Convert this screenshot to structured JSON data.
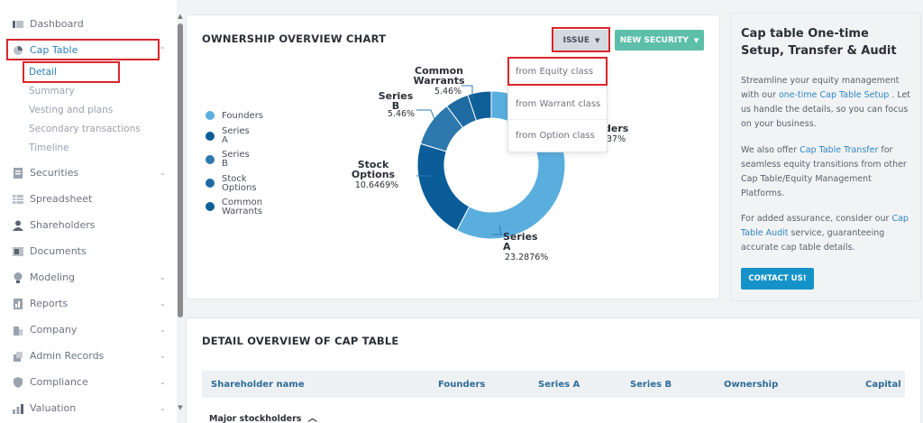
{
  "sidebar": {
    "items": [
      {
        "label": "Dashboard",
        "icon": "dashboard-icon",
        "chevron": false
      },
      {
        "label": "Cap Table",
        "icon": "pie-chart-icon",
        "chevron": true
      },
      {
        "label": "Securities",
        "icon": "securities-icon",
        "chevron": true
      },
      {
        "label": "Spreadsheet",
        "icon": "spreadsheet-icon",
        "chevron": false
      },
      {
        "label": "Shareholders",
        "icon": "user-icon",
        "chevron": false
      },
      {
        "label": "Documents",
        "icon": "document-icon",
        "chevron": false
      },
      {
        "label": "Modeling",
        "icon": "bulb-icon",
        "chevron": true
      },
      {
        "label": "Reports",
        "icon": "report-icon",
        "chevron": true
      },
      {
        "label": "Company",
        "icon": "company-icon",
        "chevron": true
      },
      {
        "label": "Admin Records",
        "icon": "admin-icon",
        "chevron": true
      },
      {
        "label": "Compliance",
        "icon": "shield-icon",
        "chevron": true
      },
      {
        "label": "Valuation",
        "icon": "valuation-icon",
        "chevron": true
      }
    ],
    "cap_table_sub": [
      "Detail",
      "Summary",
      "Vesting and plans",
      "Secondary transactions",
      "Timeline"
    ]
  },
  "chart_card": {
    "title": "OWNERSHIP OVERVIEW CHART",
    "issue_label": "ISSUE",
    "new_security_label": "NEW SECURITY",
    "dropdown": [
      "from Equity class",
      "from Warrant class",
      "from Option class"
    ]
  },
  "chart_data": {
    "type": "pie",
    "legend": [
      "Founders",
      "Series A",
      "Series B",
      "Stock Options",
      "Common Warrants"
    ],
    "legend_placement": "left",
    "slices": [
      {
        "name": "Founders",
        "value": 61.2369,
        "color": "#5aaede"
      },
      {
        "name": "Series A",
        "value": 23.2876,
        "color": "#0a5d99"
      },
      {
        "name": "Stock Options",
        "value": 10.6469,
        "color": "#2d78ad"
      },
      {
        "name": "Series B",
        "value": 5.46,
        "color": "#1e6aa3"
      },
      {
        "name": "Common Warrants",
        "value": 5.46,
        "color": "#0e5f98"
      }
    ],
    "labels": {
      "common_warrants": {
        "name": "Common Warrants",
        "pct": "5.46%"
      },
      "series_b": {
        "name": "Series B",
        "pct": "5.46%"
      },
      "stock_options": {
        "name": "Stock Options",
        "pct": "10.6469%"
      },
      "series_a": {
        "name": "Series A",
        "pct": "23.2876%"
      },
      "founders_partial": {
        "name": "ders",
        "pct": "37%"
      }
    }
  },
  "info_card": {
    "title": "Cap table One-time Setup, Transfer & Audit",
    "p1_before": "Streamline your equity management with our ",
    "p1_link": "one-time Cap Table Setup",
    "p1_after": " . Let us handle the details, so you can focus on your business.",
    "p2_before": "We also offer ",
    "p2_link": "Cap Table Transfer",
    "p2_after": " for seamless equity transitions from other Cap Table/Equity Management Platforms.",
    "p3_before": "For added assurance, consider our ",
    "p3_link": "Cap Table Audit",
    "p3_after": " service, guaranteeing accurate cap table details.",
    "contact_label": "CONTACT US!"
  },
  "detail_card": {
    "title": "DETAIL OVERVIEW OF CAP TABLE",
    "columns": [
      "Shareholder name",
      "Founders",
      "Series A",
      "Series B",
      "Ownership",
      "Capital"
    ],
    "group_label": "Major stockholders"
  },
  "colors": {
    "accent_red": "#d9262c",
    "teal_button": "#5dbfa9",
    "contact_button": "#1593c8",
    "issue_button": "#d5dae0"
  }
}
